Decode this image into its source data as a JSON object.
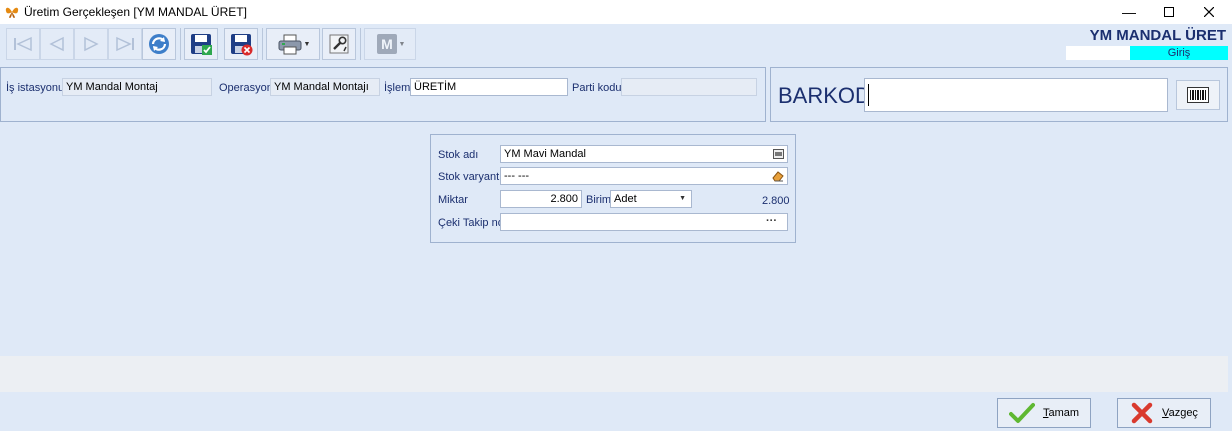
{
  "window": {
    "title": "Üretim Gerçekleşen [YM MANDAL ÜRET]"
  },
  "brand": {
    "title": "YM MANDAL ÜRET",
    "mode": "Giriş"
  },
  "header_fields": {
    "is_istasyonu": {
      "label": "İş istasyonu",
      "value": "YM Mandal Montaj"
    },
    "operasyon": {
      "label": "Operasyon",
      "value": "YM Mandal Montajı"
    },
    "islem": {
      "label": "İşlem",
      "value": "ÜRETİM"
    },
    "parti_kodu": {
      "label": "Parti kodu",
      "value": ""
    }
  },
  "barkod": {
    "label": "BARKOD",
    "value": ""
  },
  "detail": {
    "stok_adi": {
      "label": "Stok adı",
      "value": "YM Mavi Mandal"
    },
    "stok_varyanti": {
      "label": "Stok varyantı",
      "value": "--- ---"
    },
    "miktar": {
      "label": "Miktar",
      "value": "2.800"
    },
    "birim": {
      "label": "Birim",
      "value": "Adet"
    },
    "miktar_total": "2.800",
    "ceki_takip": {
      "label": "Çeki Takip no",
      "value": "",
      "ellipsis": "···"
    }
  },
  "buttons": {
    "ok": {
      "label_u": "T",
      "label_rest": "amam"
    },
    "cancel": {
      "label_u": "V",
      "label_rest": "azgeç"
    }
  },
  "icons": [
    "first-icon",
    "prev-icon",
    "next-icon",
    "last-icon",
    "refresh-icon",
    "save-icon",
    "save-delete-icon",
    "print-icon",
    "settings-icon",
    "m-icon",
    "barcode-icon",
    "check-icon",
    "x-icon"
  ],
  "colors": {
    "accent": "#1b2f6f",
    "mode_bg": "#00ffff",
    "background": "#dfe9f7"
  }
}
